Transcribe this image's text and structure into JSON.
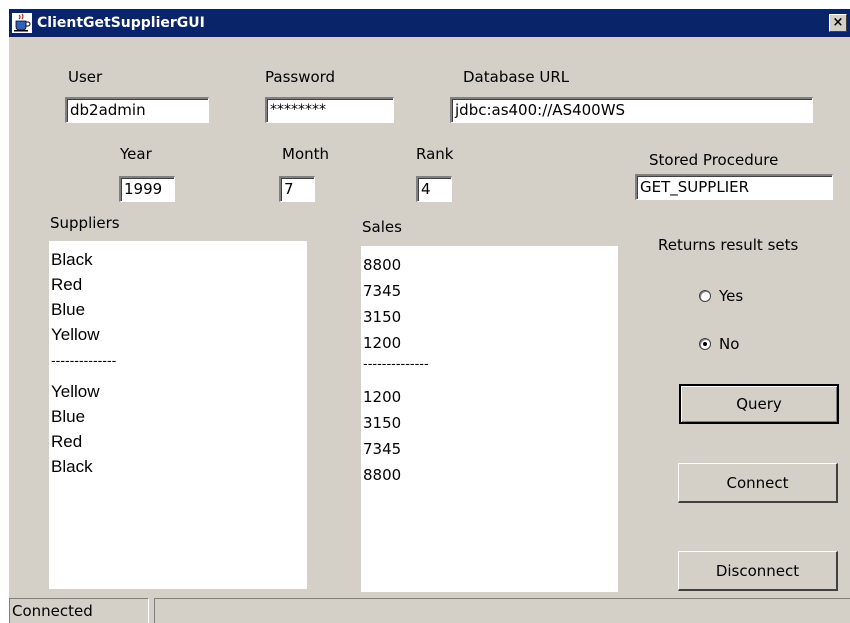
{
  "window": {
    "title": "ClientGetSupplierGUI",
    "icon": "java-cup-icon",
    "close_glyph": "×"
  },
  "labels": {
    "user": "User",
    "password": "Password",
    "database_url": "Database URL",
    "year": "Year",
    "month": "Month",
    "rank": "Rank",
    "stored_procedure": "Stored Procedure",
    "suppliers": "Suppliers",
    "sales": "Sales",
    "returns_result_sets": "Returns result sets"
  },
  "fields": {
    "user": "db2admin",
    "password": "********",
    "database_url": "jdbc:as400://AS400WS",
    "year": "1999",
    "month": "7",
    "rank": "4",
    "stored_procedure": "GET_SUPPLIER"
  },
  "suppliers": [
    "Black",
    "Red",
    "Blue",
    "Yellow",
    "--------------",
    "Yellow",
    "Blue",
    "Red",
    "Black"
  ],
  "sales": [
    "8800",
    "7345",
    "3150",
    "1200",
    "--------------",
    "1200",
    "3150",
    "7345",
    "8800"
  ],
  "radio": {
    "yes": "Yes",
    "no": "No",
    "selected": "No"
  },
  "buttons": {
    "query": "Query",
    "connect": "Connect",
    "disconnect": "Disconnect"
  },
  "status": {
    "text": "Connected"
  },
  "colors": {
    "titlebar": "#0a246a",
    "window_bg": "#d4d0c8"
  }
}
